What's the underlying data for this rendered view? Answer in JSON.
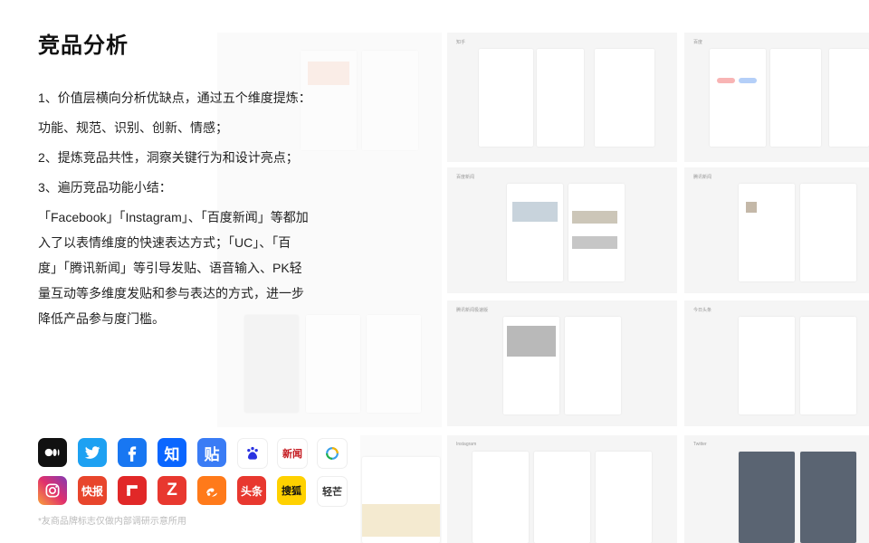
{
  "page": {
    "title": "竞品分析",
    "points": [
      "1、价值层横向分析优缺点，通过五个维度提炼：",
      "功能、规范、识别、创新、情感；",
      "2、提炼竞品共性，洞察关键行为和设计亮点；",
      "3、遍历竞品功能小结："
    ],
    "summary": "「Facebook」「Instagram」、「百度新闻」等都加入了以表情维度的快速表达方式；「UC」、「百度」「腾讯新闻」等引导发贴、语音输入、PK轻量互动等多维度发贴和参与表达的方式，进一步降低产品参与度门槛。",
    "footnote": "*友商品牌标志仅做内部调研示意所用"
  },
  "logos": [
    {
      "name": "medium-logo",
      "text": "",
      "color": "#111111"
    },
    {
      "name": "twitter-logo",
      "text": "",
      "color": "#1da1f2"
    },
    {
      "name": "facebook-logo",
      "text": "",
      "color": "#1877f2"
    },
    {
      "name": "zhihu-logo",
      "text": "知",
      "color": "#0a66ff"
    },
    {
      "name": "tieba-logo",
      "text": "贴",
      "color": "#3a7cf5"
    },
    {
      "name": "baidu-logo",
      "text": "",
      "color": "#ffffff"
    },
    {
      "name": "netease-news-logo",
      "text": "新闻",
      "color": "#ffffff"
    },
    {
      "name": "tencent-news-logo",
      "text": "",
      "color": "#ffffff"
    },
    {
      "name": "instagram-logo",
      "text": "",
      "color": "#c13584"
    },
    {
      "name": "kuaibao-logo",
      "text": "快报",
      "color": "#e8452c"
    },
    {
      "name": "flipboard-logo",
      "text": "",
      "color": "#e12828"
    },
    {
      "name": "zaker-logo",
      "text": "Z",
      "color": "#e8382f"
    },
    {
      "name": "uc-logo",
      "text": "",
      "color": "#ff7a1a"
    },
    {
      "name": "toutiao-logo",
      "text": "头条",
      "color": "#e8382f"
    },
    {
      "name": "sohu-logo",
      "text": "搜狐",
      "color": "#ffd100"
    },
    {
      "name": "qingmang-logo",
      "text": "轻芒",
      "color": "#ffffff"
    }
  ],
  "screens": [
    {
      "label": "知乎",
      "captions": [
        "",
        "",
        ""
      ]
    },
    {
      "label": "百度",
      "captions": [
        "",
        "",
        ""
      ]
    },
    {
      "label": "百度新闻",
      "captions": [
        "",
        ""
      ]
    },
    {
      "label": "腾讯新闻",
      "captions": [
        "",
        ""
      ]
    },
    {
      "label": "腾讯新闻极速版",
      "captions": [
        "",
        ""
      ]
    },
    {
      "label": "今日头条",
      "captions": [
        "",
        ""
      ]
    },
    {
      "label": "Instagram",
      "captions": []
    },
    {
      "label": "Twitter",
      "captions": []
    }
  ]
}
